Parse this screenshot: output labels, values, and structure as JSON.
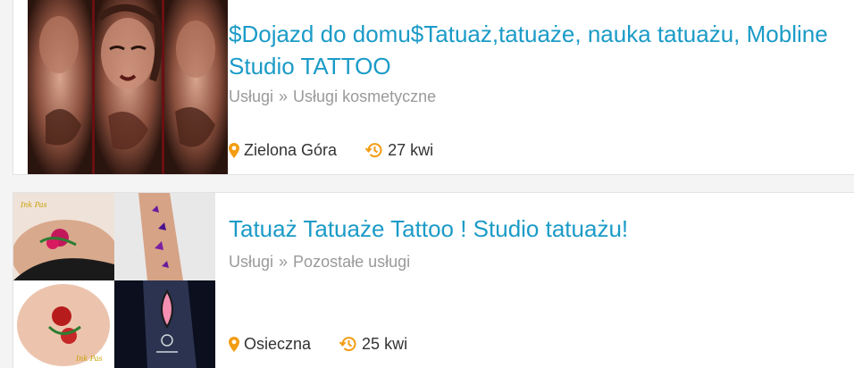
{
  "listings": [
    {
      "title": "$Dojazd do domu$Tatuaż,tatuaże, nauka tatuażu, Mobline Studio TATTOO",
      "category_path": [
        "Usługi",
        "Usługi kosmetyczne"
      ],
      "location": "Zielona Góra",
      "date": "27 kwi"
    },
    {
      "title": "Tatuaż Tatuaże Tattoo ! Studio tatuażu!",
      "category_path": [
        "Usługi",
        "Pozostałe usługi"
      ],
      "location": "Osieczna",
      "date": "25 kwi"
    }
  ],
  "separator": "»",
  "thumbnail_watermark": "Ink Pas",
  "colors": {
    "title": "#1b9bc7",
    "category": "#9a9a9a",
    "meta_text": "#333333",
    "icon_orange": "#f39c12"
  },
  "icons": {
    "location": "map-pin-icon",
    "date": "history-clock-icon"
  }
}
